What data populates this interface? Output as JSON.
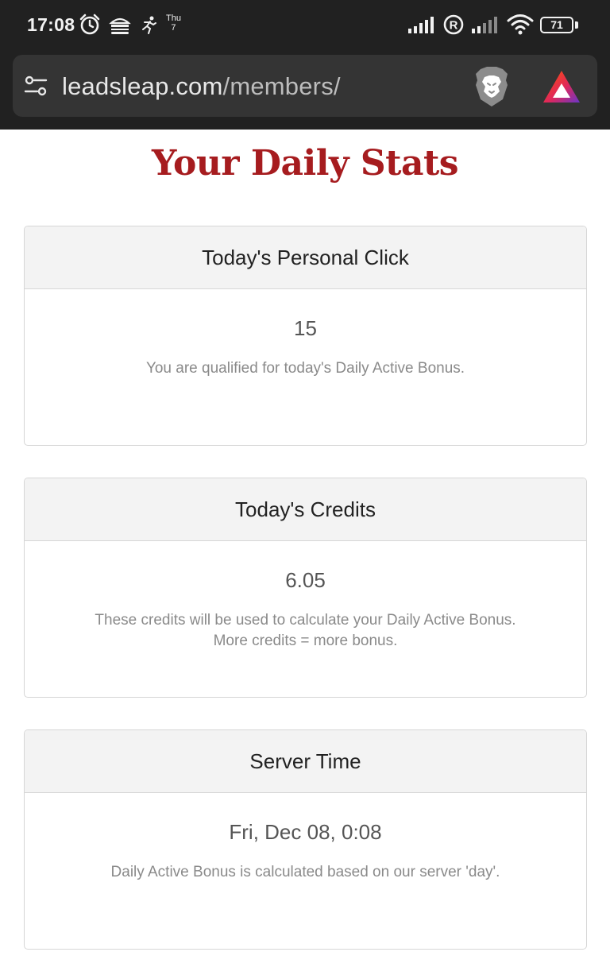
{
  "status_bar": {
    "time": "17:08",
    "day_name": "Thu",
    "day_number": "7",
    "battery": "71",
    "icons": [
      "alarm-icon",
      "hamburger-icon",
      "runner-icon",
      "calendar-icon",
      "signal-icon",
      "registered-icon",
      "signal-weak-icon",
      "wifi-icon",
      "battery-icon"
    ]
  },
  "browser": {
    "url_domain": "leadsleap.com",
    "url_path": "/members/",
    "icons": [
      "site-settings-icon",
      "brave-shield-icon",
      "brave-rewards-icon"
    ]
  },
  "page": {
    "title": "Your Daily Stats"
  },
  "cards": [
    {
      "header": "Today's Personal Click",
      "value": "15",
      "note_line1": "You are qualified for today's Daily Active Bonus.",
      "note_line2": ""
    },
    {
      "header": "Today's Credits",
      "value": "6.05",
      "note_line1": "These credits will be used to calculate your Daily Active Bonus.",
      "note_line2": "More credits = more bonus."
    },
    {
      "header": "Server Time",
      "value": "Fri, Dec 08, 0:08",
      "note_line1": "Daily Active Bonus is calculated based on our server 'day'.",
      "note_line2": ""
    }
  ],
  "colors": {
    "title": "#a61c1f",
    "browser_chrome": "#212121",
    "url_field": "#343434"
  }
}
